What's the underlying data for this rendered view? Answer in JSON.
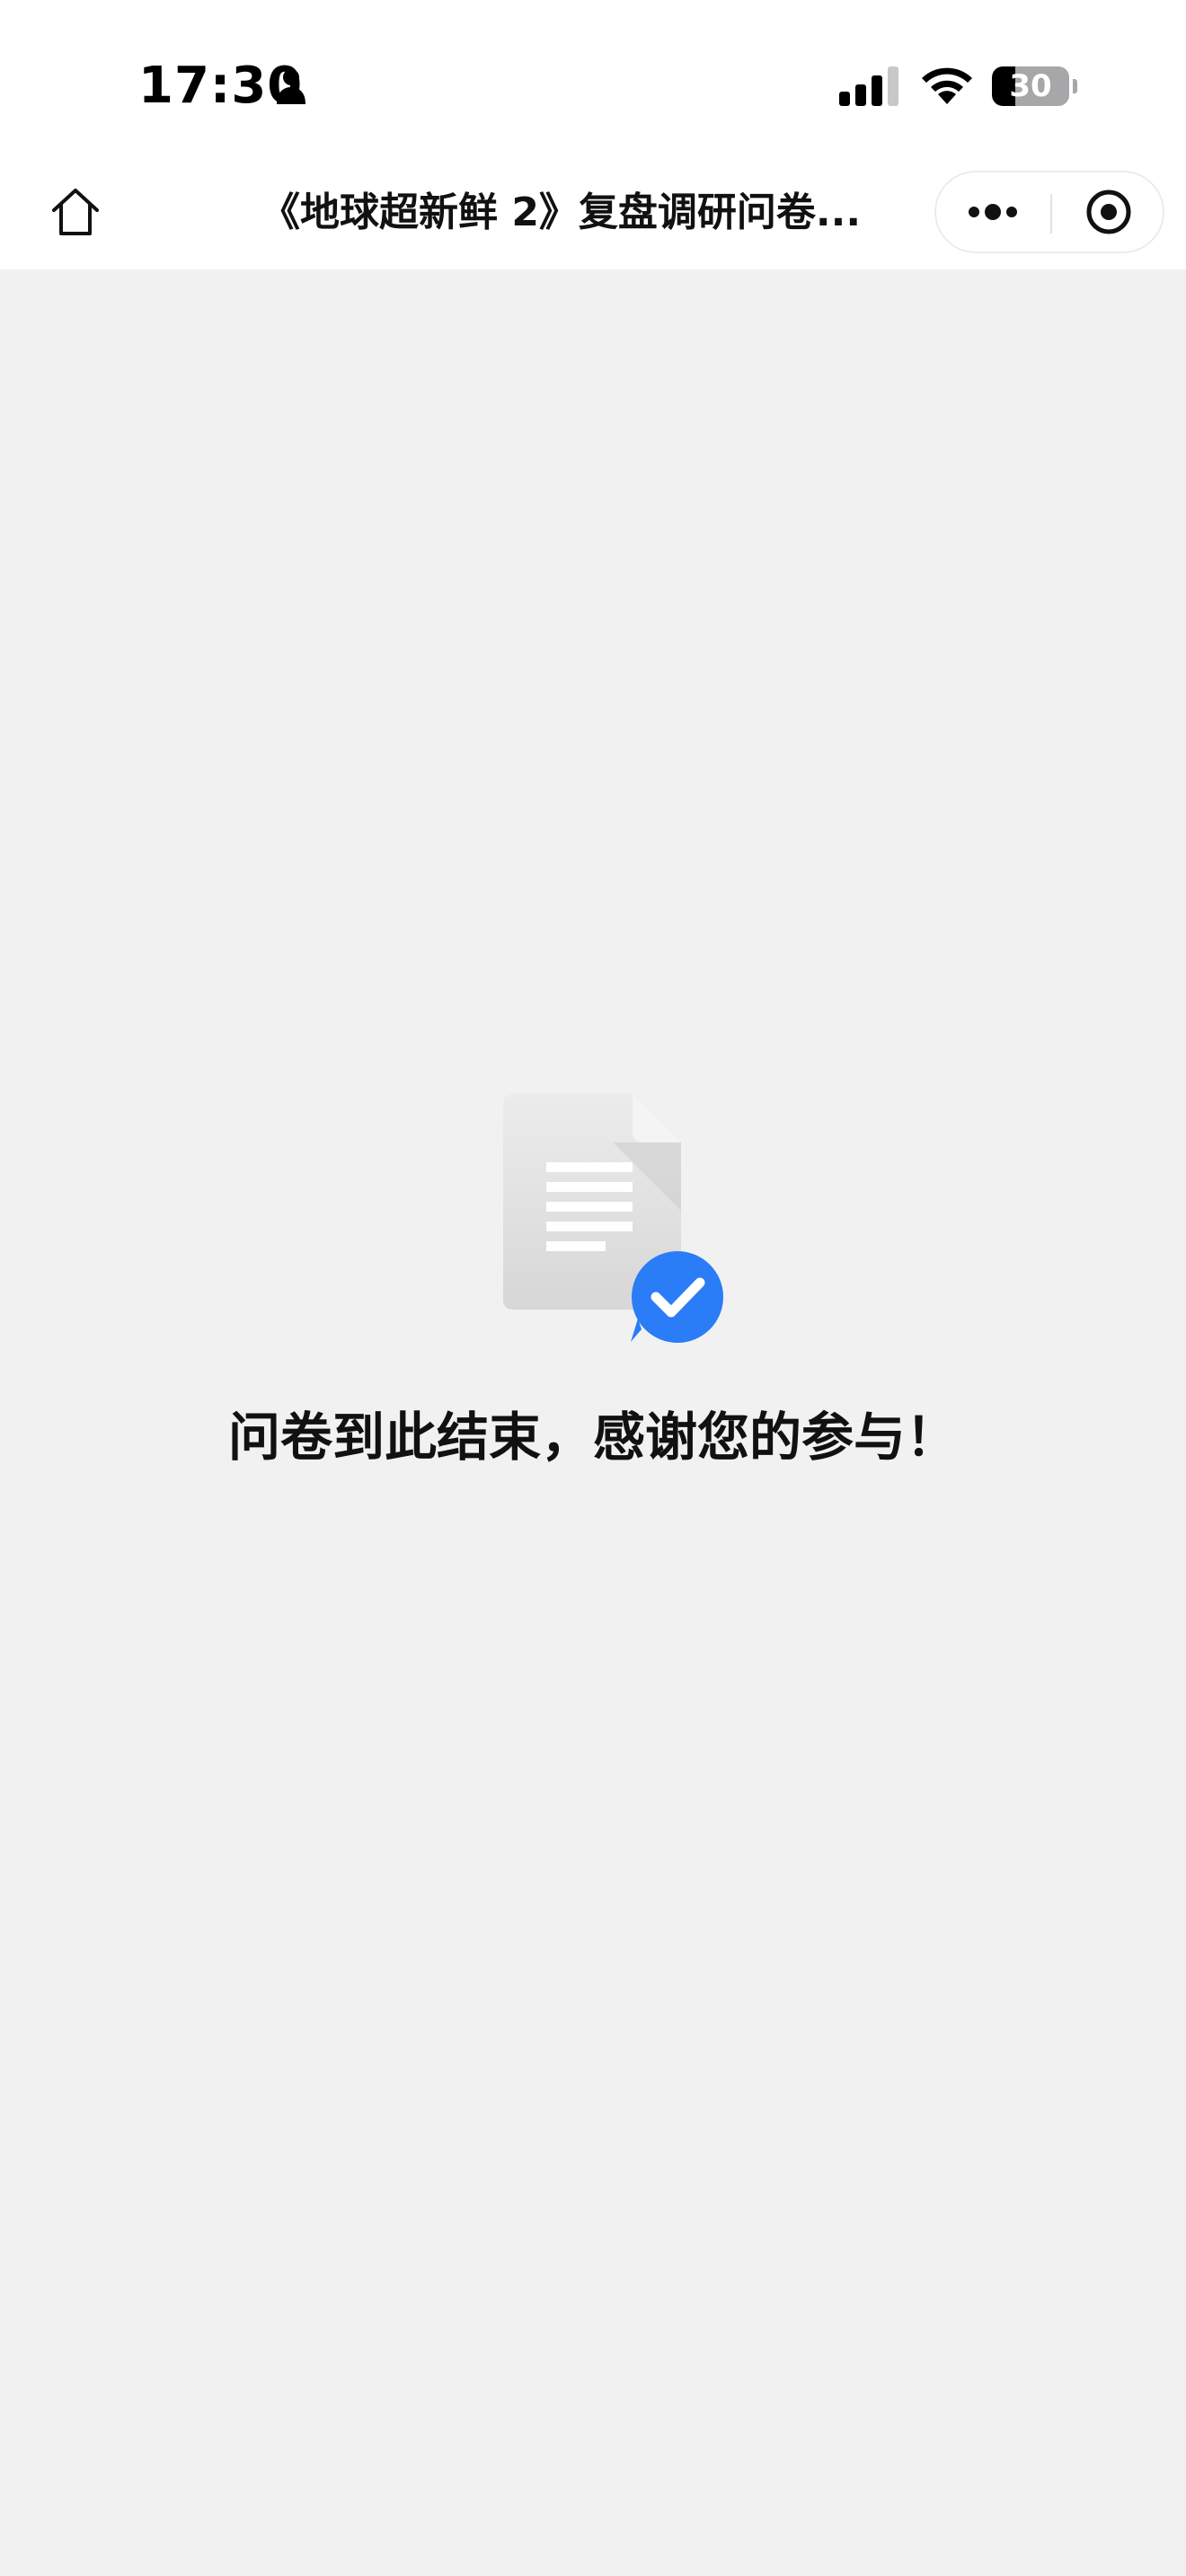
{
  "status_bar": {
    "time": "17:30",
    "battery_level": "30",
    "battery_fraction": 0.3
  },
  "nav_bar": {
    "title": "《地球超新鲜 2》复盘调研问卷..."
  },
  "main": {
    "message": "问卷到此结束，感谢您的参与！"
  },
  "colors": {
    "background": "#f1f1f2",
    "bar_background": "#ffffff",
    "accent_blue": "#2a7cf7"
  },
  "icons": {
    "status": [
      "person-icon",
      "signal-icon",
      "wifi-icon",
      "battery-icon"
    ],
    "nav": [
      "home-icon",
      "more-dots-icon",
      "close-target-icon"
    ],
    "content": [
      "document-icon",
      "check-badge-icon"
    ]
  }
}
